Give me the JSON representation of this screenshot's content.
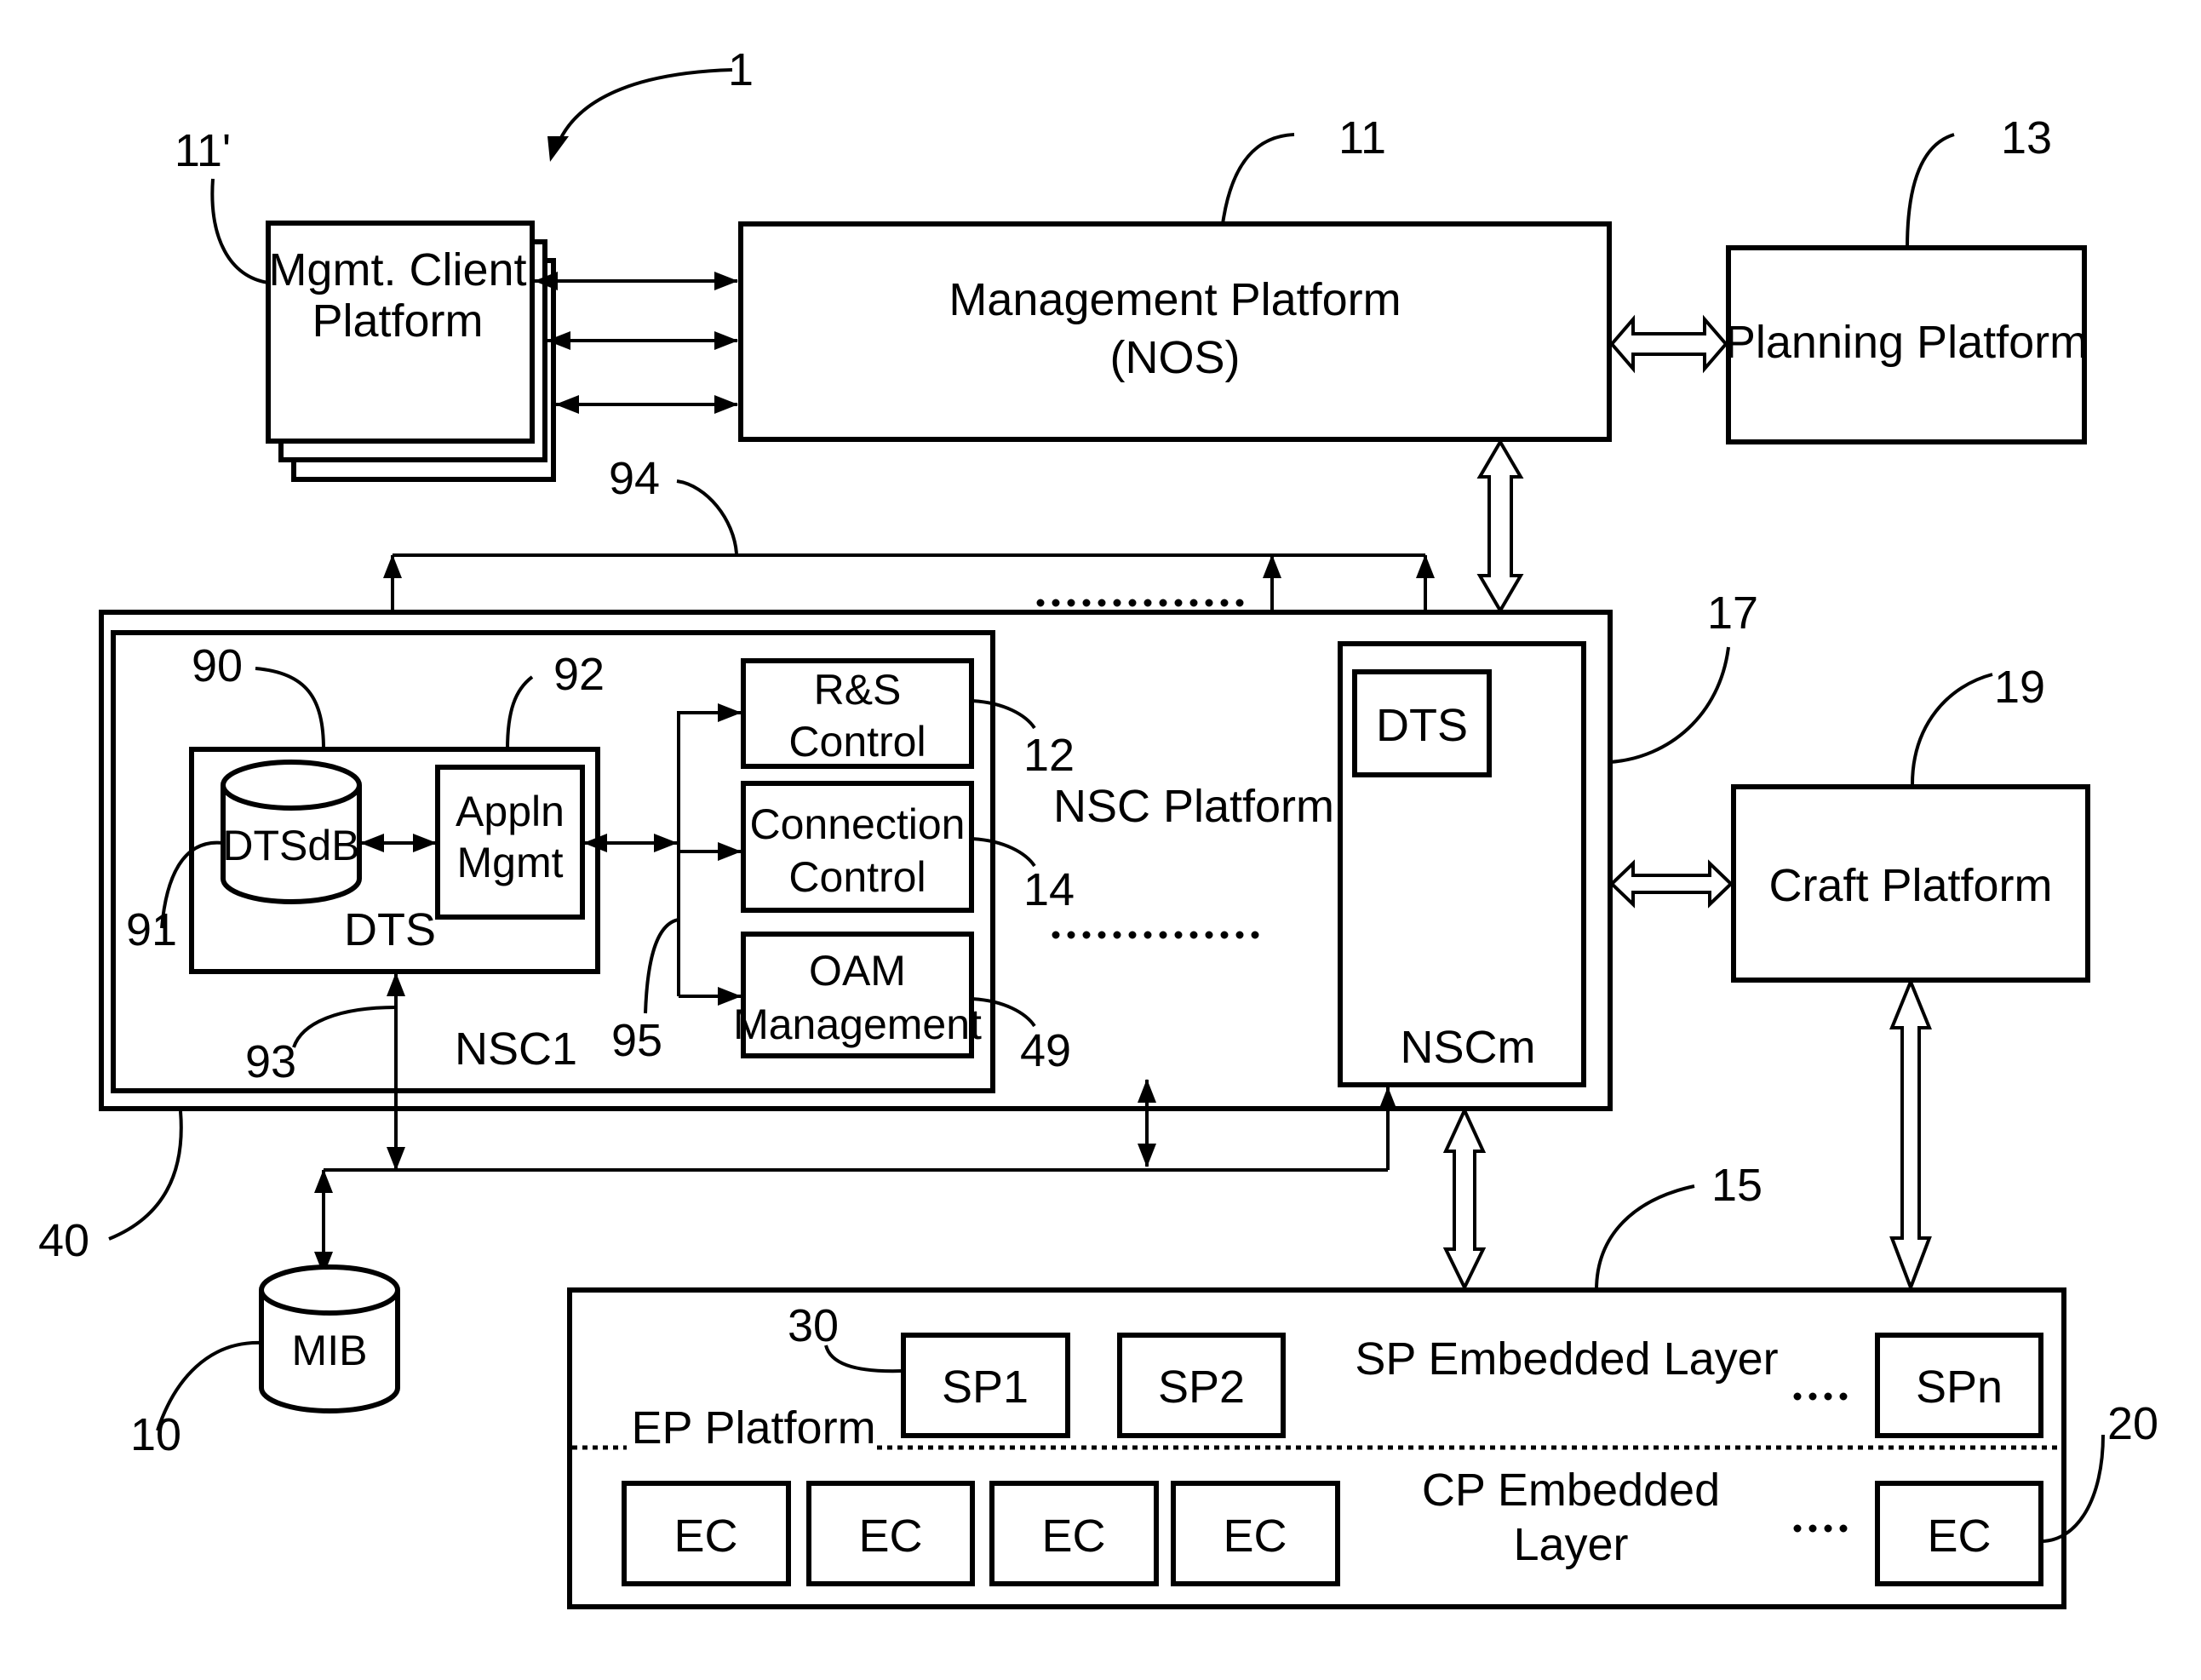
{
  "figure": {
    "ref": "1",
    "components": {
      "mgmt_client": {
        "ref": "11'",
        "line1": "Mgmt. Client",
        "line2": "Platform"
      },
      "management_platform": {
        "ref": "11",
        "line1": "Management Platform",
        "line2": "(NOS)"
      },
      "planning_platform": {
        "ref": "13",
        "label": "Planning Platform"
      },
      "nsc_platform": {
        "ref": "17",
        "label": "NSC Platform"
      },
      "nsc_outer": {
        "ref": "40"
      },
      "nsc1": {
        "label": "NSC1",
        "dts": {
          "ref": "90",
          "label": "DTS"
        },
        "dtsdb": {
          "ref": "91",
          "label": "DTSdB"
        },
        "appln_mgmt": {
          "ref": "92",
          "line1": "Appln",
          "line2": "Mgmt"
        },
        "dts_link_ref": "93",
        "bus_ref": "95",
        "rs_control": {
          "ref": "12",
          "line1": "R&S",
          "line2": "Control"
        },
        "connection_control": {
          "ref": "14",
          "line1": "Connection",
          "line2": "Control"
        },
        "oam_management": {
          "ref": "49",
          "line1": "OAM",
          "line2": "Management"
        }
      },
      "nscm": {
        "label": "NSCm",
        "dts_label": "DTS"
      },
      "dts_bus_ref": "94",
      "craft_platform": {
        "ref": "19",
        "label": "Craft Platform"
      },
      "mib": {
        "ref": "10",
        "label": "MIB"
      },
      "ep_platform": {
        "ref": "15",
        "label": "EP Platform",
        "sp_layer_label": "SP Embedded Layer",
        "cp_layer_line1": "CP Embedded",
        "cp_layer_line2": "Layer",
        "sp_ref": "30",
        "ec_ref": "20",
        "sp_items": [
          "SP1",
          "SP2",
          "SPn"
        ],
        "ec_items": [
          "EC",
          "EC",
          "EC",
          "EC",
          "EC"
        ]
      }
    }
  }
}
